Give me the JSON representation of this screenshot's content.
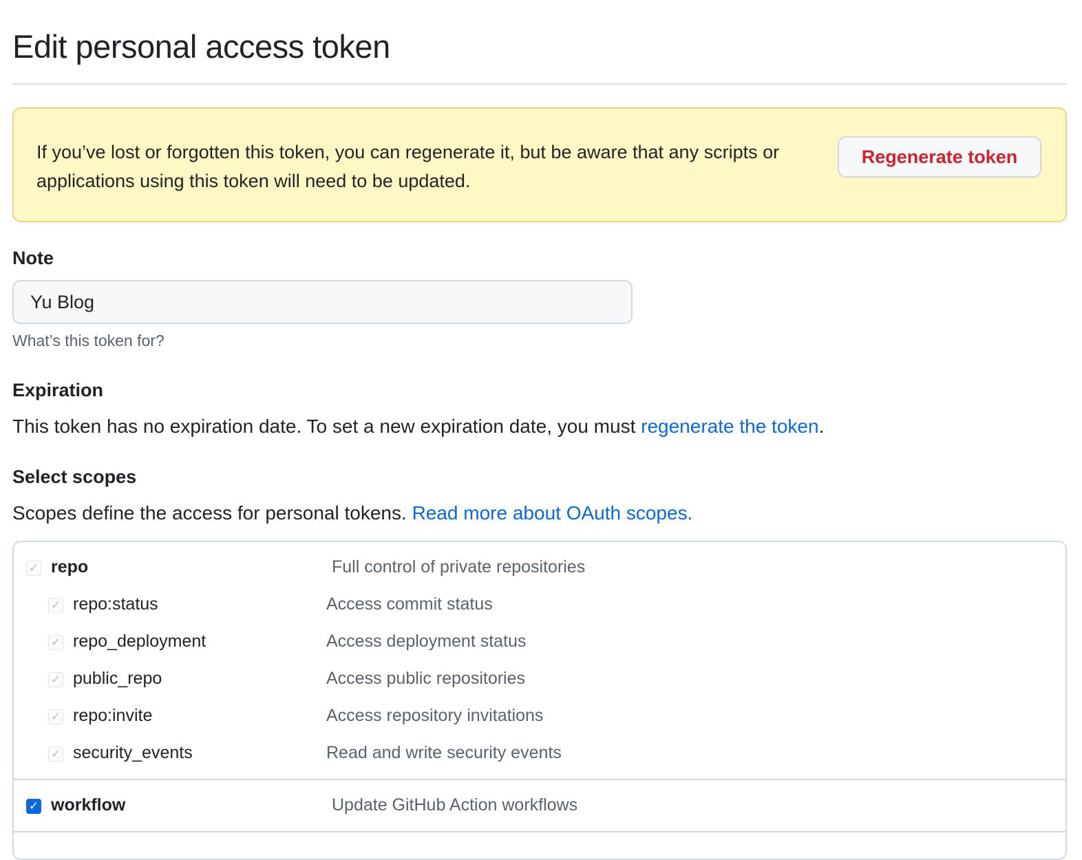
{
  "page": {
    "title": "Edit personal access token"
  },
  "flash": {
    "message": "If you’ve lost or forgotten this token, you can regenerate it, but be aware that any scripts or applications using this token will need to be updated.",
    "regenerate_label": "Regenerate token"
  },
  "note": {
    "label": "Note",
    "value": "Yu Blog",
    "hint": "What’s this token for?"
  },
  "expiration": {
    "label": "Expiration",
    "text": "This token has no expiration date. To set a new expiration date, you must ",
    "link": "regenerate the token",
    "suffix": "."
  },
  "scopes": {
    "label": "Select scopes",
    "text": "Scopes define the access for personal tokens. ",
    "link": "Read more about OAuth scopes.",
    "items": [
      {
        "name": "repo",
        "desc": "Full control of private repositories",
        "checked": true,
        "disabled": true
      },
      {
        "name": "repo:status",
        "desc": "Access commit status",
        "checked": true,
        "disabled": true
      },
      {
        "name": "repo_deployment",
        "desc": "Access deployment status",
        "checked": true,
        "disabled": true
      },
      {
        "name": "public_repo",
        "desc": "Access public repositories",
        "checked": true,
        "disabled": true
      },
      {
        "name": "repo:invite",
        "desc": "Access repository invitations",
        "checked": true,
        "disabled": true
      },
      {
        "name": "security_events",
        "desc": "Read and write security events",
        "checked": true,
        "disabled": true
      },
      {
        "name": "workflow",
        "desc": "Update GitHub Action workflows",
        "checked": true,
        "disabled": false
      }
    ]
  },
  "colors": {
    "accent": "#0969da",
    "danger": "#cf222e",
    "flash_bg": "#fff8c5"
  }
}
